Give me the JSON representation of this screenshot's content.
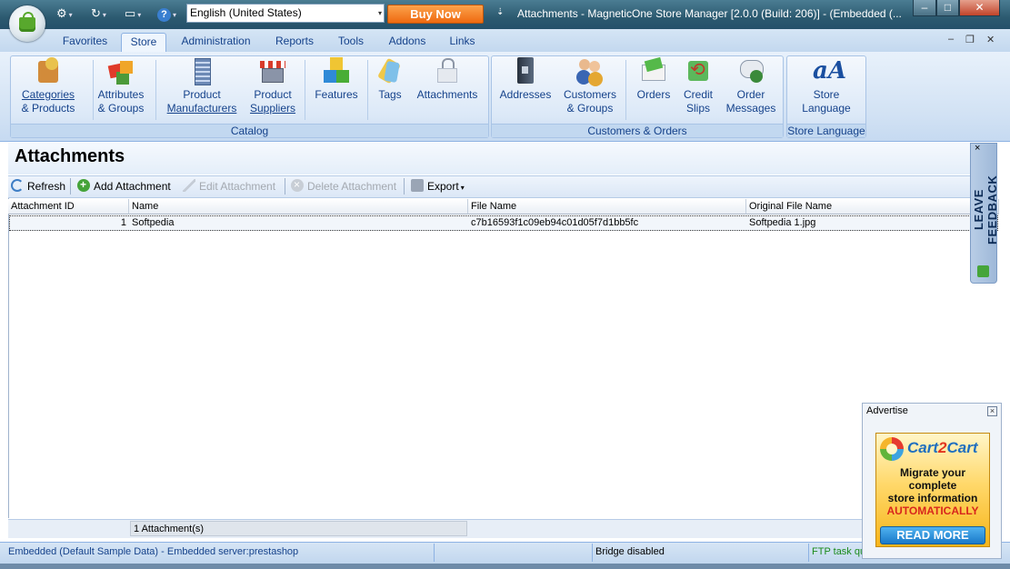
{
  "window": {
    "title": "Attachments - MagneticOne Store Manager [2.0.0 (Build: 206)] - (Embedded (...",
    "language": "English (United States)",
    "buy_now": "Buy Now",
    "minimize": "–",
    "maximize": "□",
    "close": "✕"
  },
  "quick_access": {
    "settings_icon": "⚙",
    "sync_icon": "↻",
    "windows_icon": "▭",
    "help_icon": "?",
    "caret": "▾",
    "title_dropdown": "⇣"
  },
  "menu": {
    "tabs": [
      "Favorites",
      "Store",
      "Administration",
      "Reports",
      "Tools",
      "Addons",
      "Links"
    ],
    "active": "Store",
    "mdi_minimize": "–",
    "mdi_restore": "❐",
    "mdi_close": "✕"
  },
  "ribbon": {
    "catalog": {
      "label": "Catalog",
      "items": [
        {
          "line1": "Categories",
          "line2": "& Products"
        },
        {
          "line1": "Attributes",
          "line2": "& Groups"
        },
        {
          "line1": "Product",
          "line2": "Manufacturers"
        },
        {
          "line1": "Product",
          "line2": "Suppliers"
        },
        {
          "line1": "Features",
          "line2": ""
        },
        {
          "line1": "Tags",
          "line2": ""
        },
        {
          "line1": "Attachments",
          "line2": ""
        }
      ]
    },
    "customers_orders": {
      "label": "Customers & Orders",
      "items": [
        {
          "line1": "Addresses",
          "line2": ""
        },
        {
          "line1": "Customers",
          "line2": "& Groups"
        },
        {
          "line1": "Orders",
          "line2": ""
        },
        {
          "line1": "Credit",
          "line2": "Slips"
        },
        {
          "line1": "Order",
          "line2": "Messages"
        }
      ]
    },
    "store_language": {
      "label": "Store Language",
      "icon_glyph": "aA",
      "items": [
        {
          "line1": "Store",
          "line2": "Language"
        }
      ]
    }
  },
  "page": {
    "title": "Attachments"
  },
  "toolbar": {
    "refresh": "Refresh",
    "add": "Add Attachment",
    "edit": "Edit Attachment",
    "delete": "Delete Attachment",
    "export": "Export",
    "export_caret": "▾"
  },
  "grid": {
    "columns": [
      "Attachment ID",
      "Name",
      "File Name",
      "Original File Name"
    ],
    "rows": [
      {
        "id": "1",
        "name": "Softpedia",
        "file_name": "c7b16593f1c09eb94c01d05f7d1bb5fc",
        "original_file_name": "Softpedia 1.jpg"
      }
    ],
    "summary": "1 Attachment(s)"
  },
  "status": {
    "connection": "Embedded (Default Sample Data) - Embedded server:prestashop",
    "bridge": "Bridge disabled",
    "ftp": "FTP task qu"
  },
  "feedback": {
    "label": "LEAVE FEEDBACK",
    "close": "×"
  },
  "advertise": {
    "title": "Advertise",
    "close": "×",
    "brand_a": "Cart",
    "brand_b": "2",
    "brand_c": "Cart",
    "line1": "Migrate your",
    "line2": "complete",
    "line3": "store information",
    "line4": "AUTOMATICALLY",
    "button": "READ MORE"
  },
  "colors": {
    "accent_orange": "#ef6a10",
    "ribbon_text": "#15428b",
    "status_green": "#1a8a1a"
  }
}
